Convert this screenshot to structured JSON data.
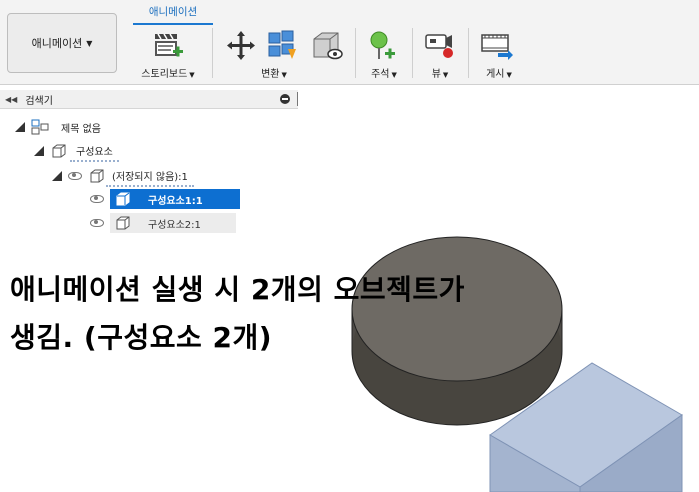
{
  "toolbar": {
    "workspace_label": "애니메이션",
    "active_tab": "애니메이션",
    "groups": {
      "storyboard": "스토리보드",
      "transform": "변환",
      "annotate": "주석",
      "view": "뷰",
      "publish": "게시"
    }
  },
  "browser": {
    "title": "검색기",
    "root": "제목 없음",
    "component_group": "구성요소",
    "unsaved": "(저장되지 않음):1",
    "component1": "구성요소1:1",
    "component2": "구성요소2:1"
  },
  "annotation": {
    "line1": "애니메이션 실생 시 2개의 오브젝트가",
    "line2": "생김. (구성요소 2개)"
  },
  "colors": {
    "accent": "#0d6fd1",
    "cylinder": "#6e6a64",
    "box": "#aebfd9"
  }
}
